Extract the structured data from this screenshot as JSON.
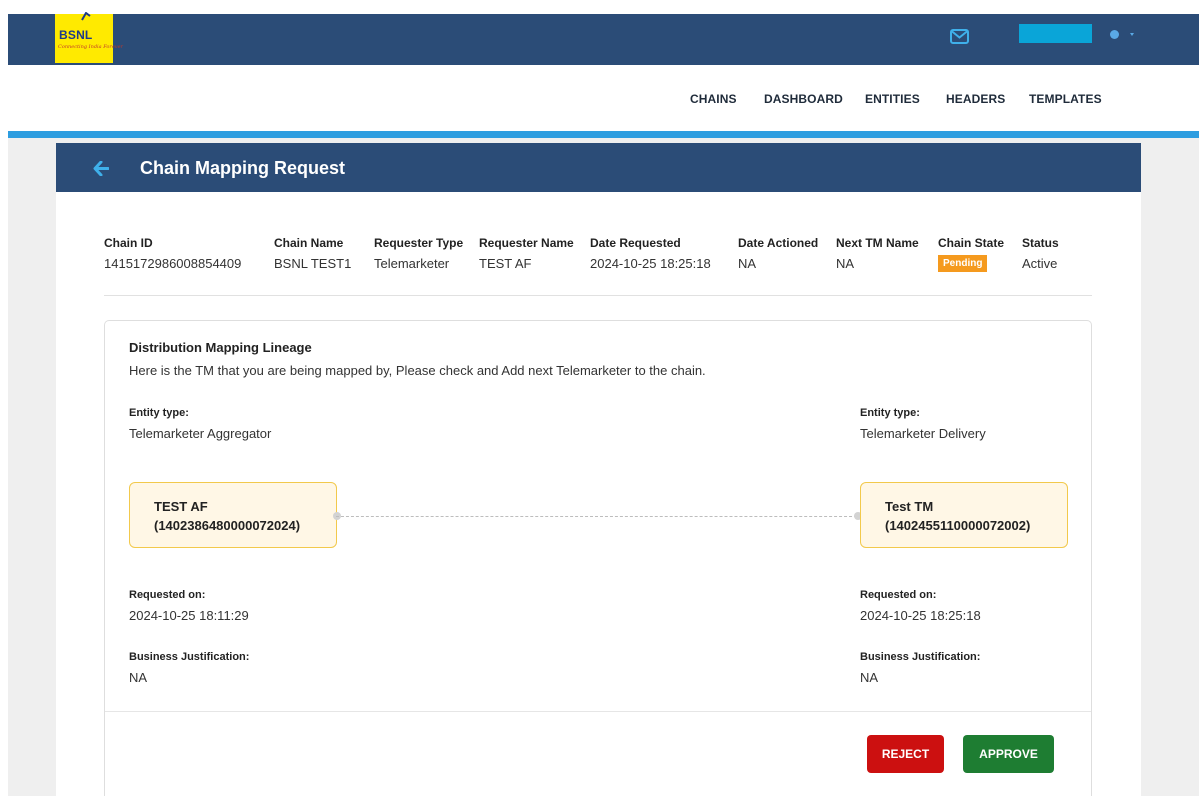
{
  "brand": {
    "logo_text": "BSNL",
    "tagline": "Connecting India Forever",
    "logo_bg": "#ffea00"
  },
  "header": {
    "mail_icon": "mail-icon",
    "user_icon": "user-circle-icon",
    "bar_color": "#2b4c77"
  },
  "nav": {
    "items": [
      "CHAINS",
      "DASHBOARD",
      "ENTITIES",
      "HEADERS",
      "TEMPLATES"
    ]
  },
  "page": {
    "title": "Chain Mapping Request",
    "back_icon": "arrow-left-icon"
  },
  "summary": {
    "fields": [
      {
        "label": "Chain ID",
        "value": "1415172986008854409"
      },
      {
        "label": "Chain Name",
        "value": "BSNL TEST1"
      },
      {
        "label": "Requester Type",
        "value": "Telemarketer"
      },
      {
        "label": "Requester Name",
        "value": "TEST AF"
      },
      {
        "label": "Date Requested",
        "value": "2024-10-25 18:25:18"
      },
      {
        "label": "Date Actioned",
        "value": "NA"
      },
      {
        "label": "Next TM Name",
        "value": "NA"
      },
      {
        "label": "Chain State",
        "value": "Pending"
      },
      {
        "label": "Status",
        "value": "Active"
      }
    ],
    "pending_color": "#f59a1e"
  },
  "lineage": {
    "title": "Distribution Mapping Lineage",
    "description": "Here is the TM that you are being mapped by, Please check and Add next Telemarketer to the chain.",
    "left": {
      "entity_type_label": "Entity type:",
      "entity_type": "Telemarketer Aggregator",
      "node_name": "TEST AF",
      "node_id": "(1402386480000072024)",
      "requested_label": "Requested on:",
      "requested_on": "2024-10-25 18:11:29",
      "justification_label": "Business Justification:",
      "justification": "NA"
    },
    "right": {
      "entity_type_label": "Entity type:",
      "entity_type": "Telemarketer Delivery",
      "node_name": "Test TM",
      "node_id": "(1402455110000072002)",
      "requested_label": "Requested on:",
      "requested_on": "2024-10-25 18:25:18",
      "justification_label": "Business Justification:",
      "justification": "NA"
    }
  },
  "actions": {
    "reject": "REJECT",
    "approve": "APPROVE",
    "reject_color": "#cc1010",
    "approve_color": "#1e7d32"
  }
}
